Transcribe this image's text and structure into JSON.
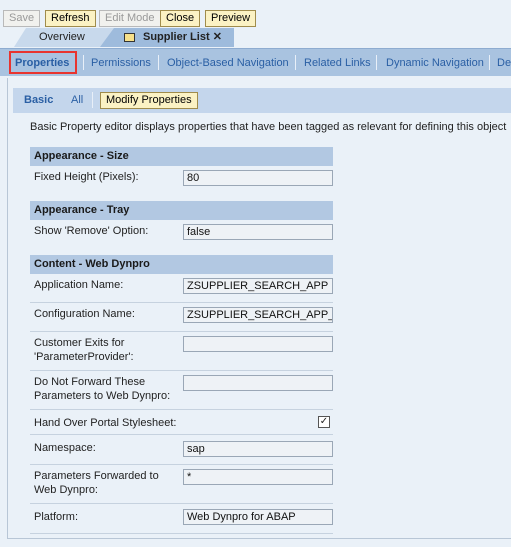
{
  "toolbar": {
    "save": "Save",
    "refresh": "Refresh",
    "edit_mode": "Edit Mode",
    "close": "Close",
    "preview": "Preview"
  },
  "tabs": {
    "overview": "Overview",
    "active": "Supplier List",
    "close_glyph": "✕"
  },
  "nav": {
    "items": [
      "Properties",
      "Permissions",
      "Object-Based Navigation",
      "Related Links",
      "Dynamic Navigation",
      "De"
    ],
    "selected": "Properties"
  },
  "sub": {
    "basic": "Basic",
    "all": "All",
    "modify": "Modify Properties"
  },
  "description": "Basic Property editor displays properties that have been tagged as relevant for defining this object",
  "sections": {
    "size": {
      "title": "Appearance - Size",
      "fixed_height_label": "Fixed Height (Pixels):",
      "fixed_height": "80"
    },
    "tray": {
      "title": "Appearance - Tray",
      "show_remove_label": "Show 'Remove' Option:",
      "show_remove": "false"
    },
    "wd": {
      "title": "Content - Web Dynpro",
      "app_label": "Application Name:",
      "app": "ZSUPPLIER_SEARCH_APP",
      "config_label": "Configuration Name:",
      "config": "ZSUPPLIER_SEARCH_APP_AC",
      "exits_label": "Customer Exits for 'ParameterProvider':",
      "exits": "",
      "noforward_label": "Do Not Forward These Parameters to Web Dynpro:",
      "noforward": "",
      "stylesheet_label": "Hand Over Portal Stylesheet:",
      "stylesheet_checked": true,
      "namespace_label": "Namespace:",
      "namespace": "sap",
      "params_label": "Parameters Forwarded to Web Dynpro:",
      "params": "*",
      "platform_label": "Platform:",
      "platform": "Web Dynpro for ABAP"
    }
  },
  "colors": {
    "highlight": "#e8342f",
    "link": "#2a5fa4",
    "button_bg": "#fbf2c4"
  }
}
